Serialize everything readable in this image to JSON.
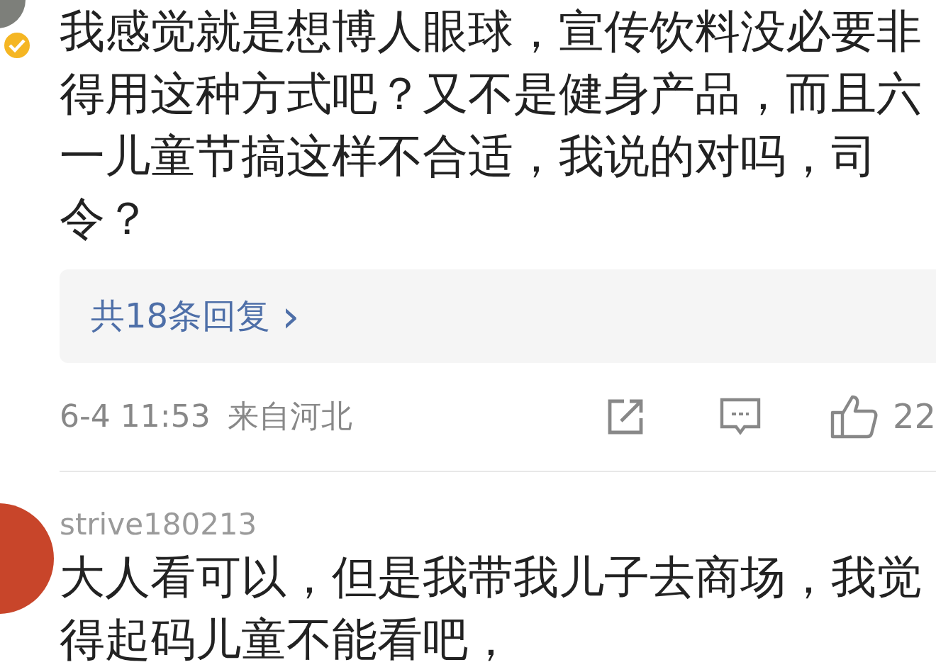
{
  "comments": [
    {
      "avatar": {
        "verified": true
      },
      "text": "我感觉就是想博人眼球，宣传饮料没必要非得用这种方式吧？又不是健身产品，而且六一儿童节搞这样不合适，我说的对吗，司令？",
      "replies": "共18条回复",
      "reply_arrow": "›",
      "time": "6-4 11:53",
      "location": "来自河北",
      "likes": "22"
    },
    {
      "avatar": {
        "verified": false
      },
      "username": "strive180213",
      "text": "大人看可以，但是我带我儿子去商场，我觉得起码儿童不能看吧，"
    }
  ]
}
